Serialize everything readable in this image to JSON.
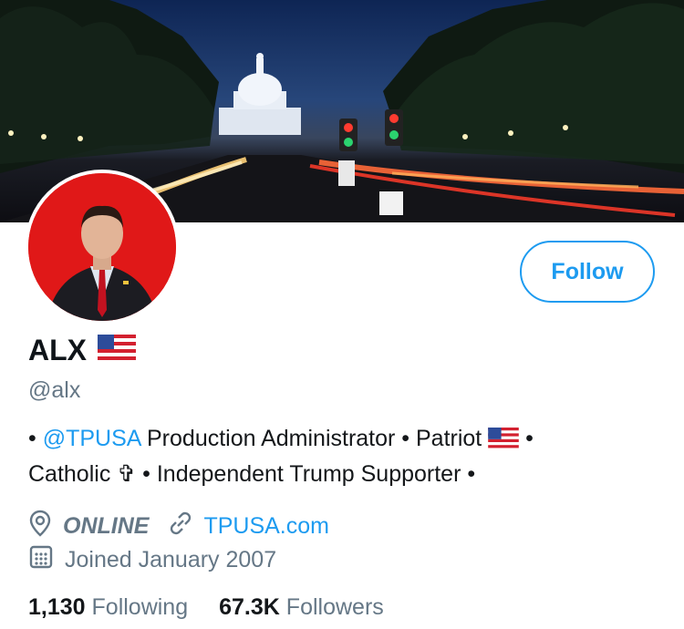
{
  "profile": {
    "name": "ALX",
    "handle": "@alx",
    "follow_label": "Follow",
    "bio": {
      "prefix": "• ",
      "mention": "@TPUSA",
      "part1": " Production Administrator • Patriot ",
      "part2": " •",
      "line2": "Catholic ✞ • Independent Trump Supporter •"
    },
    "location": "ONLINE",
    "website": "TPUSA.com",
    "joined": "Joined January 2007",
    "following_count": "1,130",
    "following_label": "Following",
    "followers_count": "67.3K",
    "followers_label": "Followers"
  },
  "icons": {
    "location": "location-pin-icon",
    "link": "link-icon",
    "calendar": "calendar-icon",
    "flag": "us-flag-icon"
  },
  "colors": {
    "accent": "#1d9bf0",
    "secondary_text": "#657786",
    "avatar_bg": "#e01818"
  }
}
